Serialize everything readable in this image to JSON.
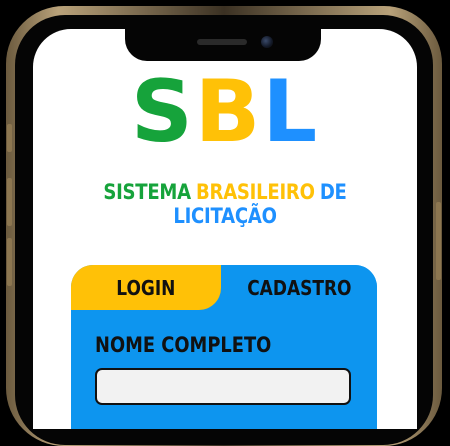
{
  "app": {
    "logo": {
      "letters": [
        "S",
        "B",
        "L"
      ],
      "colors": [
        "#16a33b",
        "#ffc107",
        "#1e90ff"
      ]
    },
    "tagline": {
      "part1": "SISTEMA",
      "part2": "BRASILEIRO",
      "part3": "DE LICITAÇÃO"
    }
  },
  "tabs": [
    {
      "label": "LOGIN",
      "active": true
    },
    {
      "label": "CADASTRO",
      "active": false
    }
  ],
  "form": {
    "full_name_label": "NOME COMPLETO",
    "full_name_value": "",
    "full_name_placeholder": ""
  },
  "colors": {
    "green": "#16a33b",
    "yellow": "#ffc107",
    "blue": "#1e90ff",
    "card": "#0d95ef"
  }
}
